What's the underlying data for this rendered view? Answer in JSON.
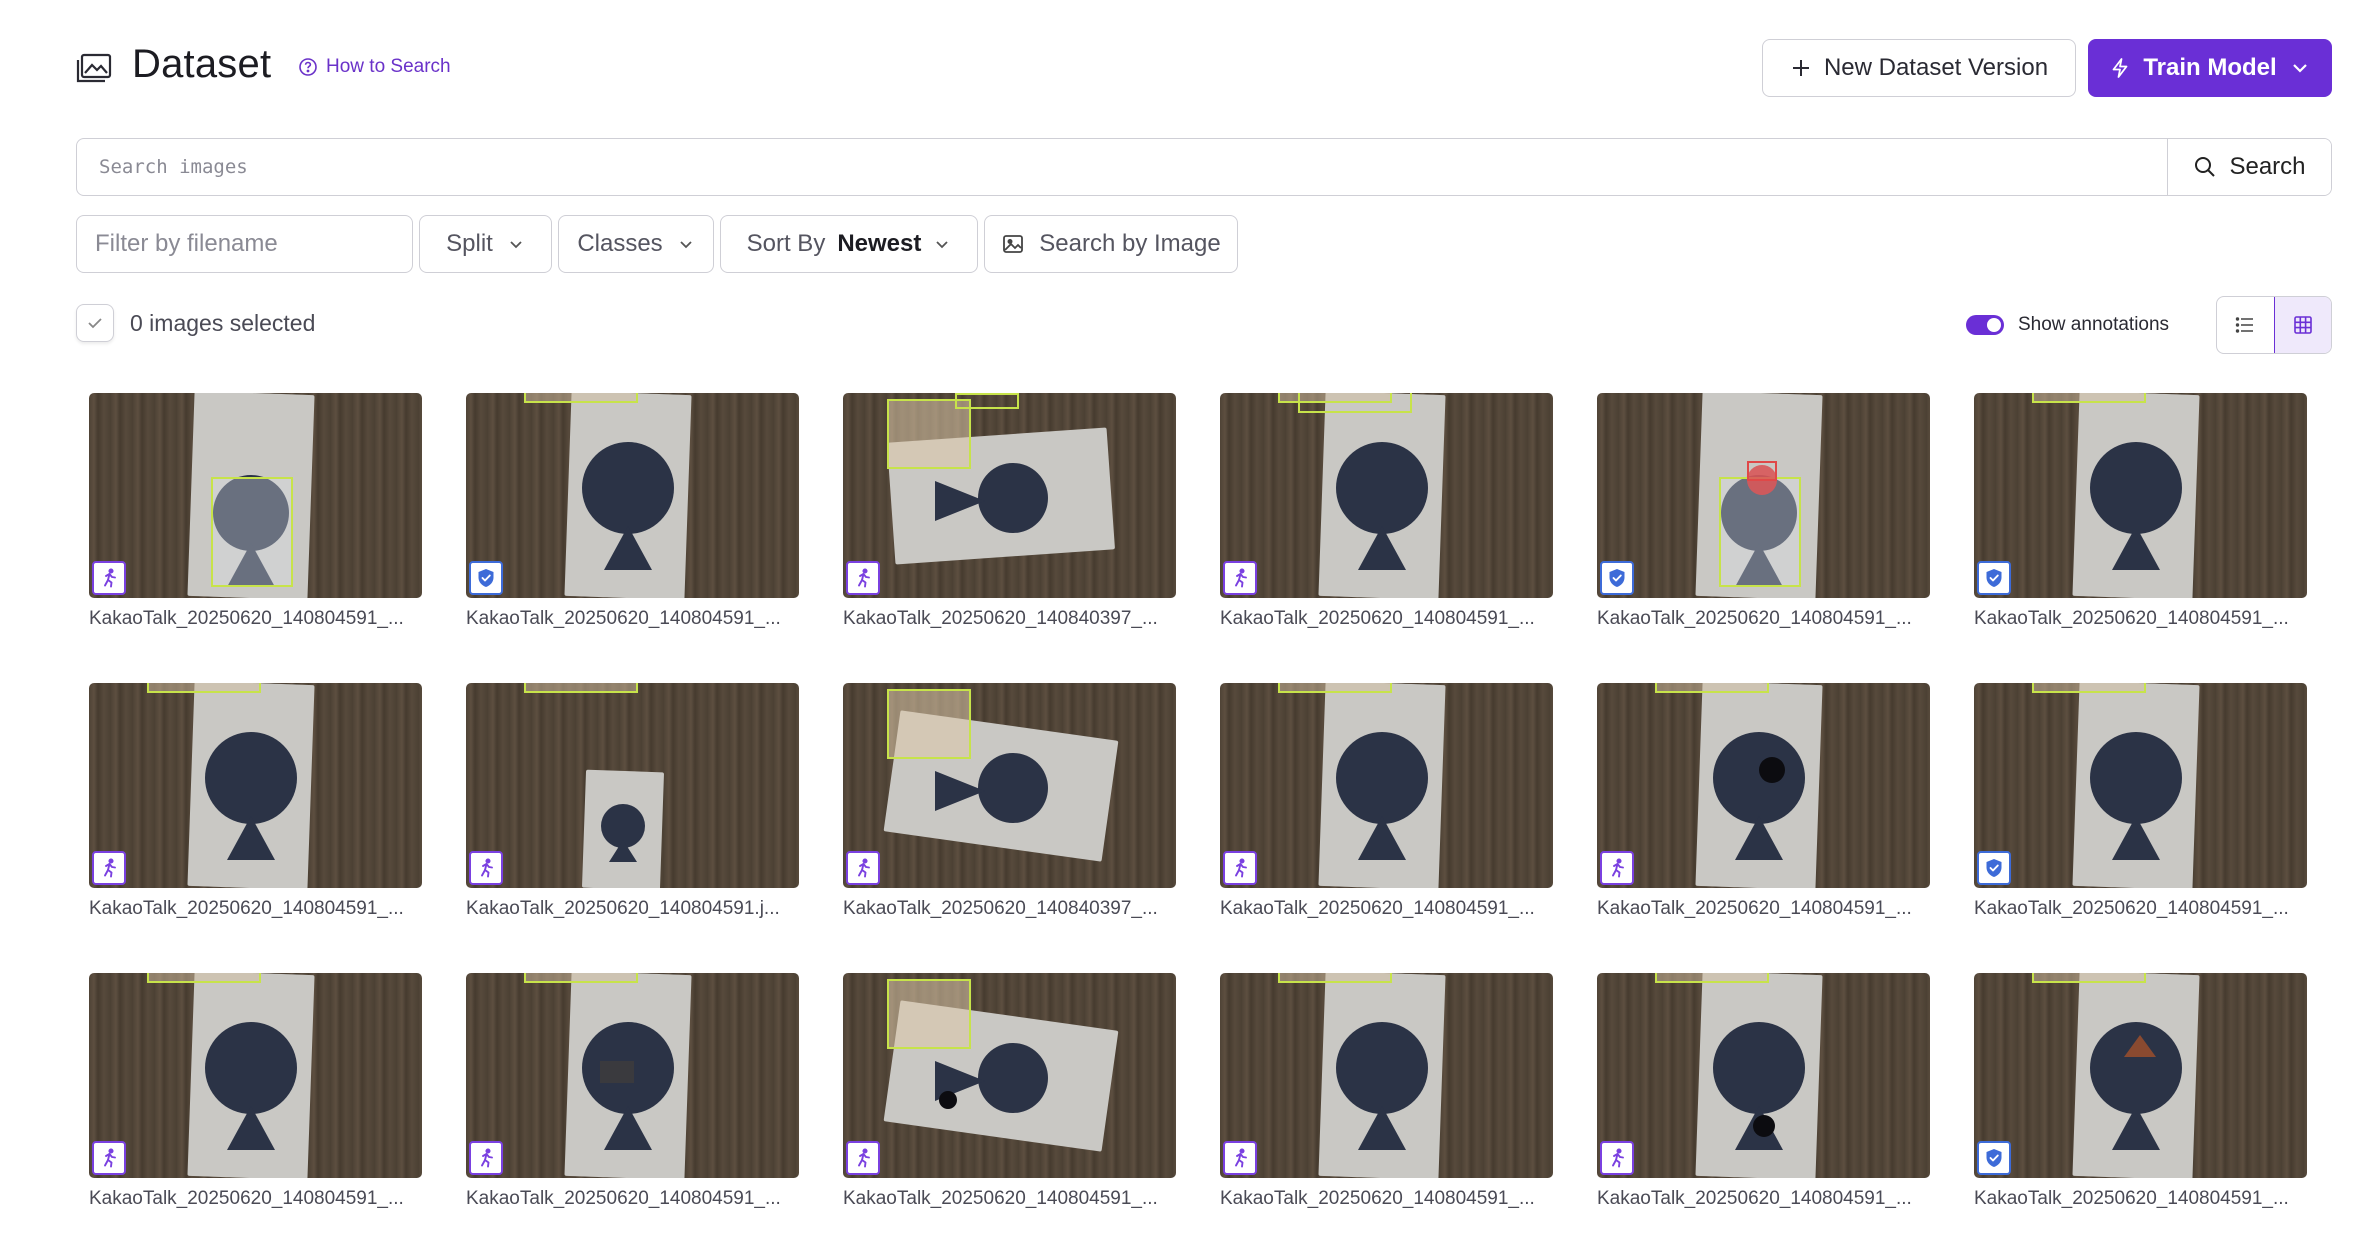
{
  "header": {
    "title": "Dataset",
    "title_icon": "image-gallery-icon",
    "how_to_search": "How to Search",
    "new_version_label": "New Dataset Version",
    "train_label": "Train Model"
  },
  "search": {
    "placeholder": "Search images",
    "button_label": "Search"
  },
  "filters": {
    "filename_placeholder": "Filter by filename",
    "split_label": "Split",
    "classes_label": "Classes",
    "sort_label": "Sort By",
    "sort_value": "Newest",
    "image_search_label": "Search by Image"
  },
  "selection": {
    "text": "0 images selected"
  },
  "annotations_toggle": {
    "label": "Show annotations",
    "on": true
  },
  "view": {
    "active": "grid"
  },
  "colors": {
    "accent": "#6a2fd6",
    "bbox": "#c7e34a",
    "train_badge": "#7a40e0",
    "valid_badge": "#3d6bd8"
  },
  "images": [
    {
      "name": "KakaoTalk_20250620_140804591_...",
      "split": "train",
      "split_icon": "running-person-icon"
    },
    {
      "name": "KakaoTalk_20250620_140804591_...",
      "split": "valid",
      "split_icon": "shield-check-icon"
    },
    {
      "name": "KakaoTalk_20250620_140840397_...",
      "split": "train",
      "split_icon": "running-person-icon"
    },
    {
      "name": "KakaoTalk_20250620_140804591_...",
      "split": "train",
      "split_icon": "running-person-icon"
    },
    {
      "name": "KakaoTalk_20250620_140804591_...",
      "split": "valid",
      "split_icon": "shield-check-icon"
    },
    {
      "name": "KakaoTalk_20250620_140804591_...",
      "split": "valid",
      "split_icon": "shield-check-icon"
    },
    {
      "name": "KakaoTalk_20250620_140804591_...",
      "split": "train",
      "split_icon": "running-person-icon"
    },
    {
      "name": "KakaoTalk_20250620_140804591.j...",
      "split": "train",
      "split_icon": "running-person-icon"
    },
    {
      "name": "KakaoTalk_20250620_140840397_...",
      "split": "train",
      "split_icon": "running-person-icon"
    },
    {
      "name": "KakaoTalk_20250620_140804591_...",
      "split": "train",
      "split_icon": "running-person-icon"
    },
    {
      "name": "KakaoTalk_20250620_140804591_...",
      "split": "train",
      "split_icon": "running-person-icon"
    },
    {
      "name": "KakaoTalk_20250620_140804591_...",
      "split": "valid",
      "split_icon": "shield-check-icon"
    },
    {
      "name": "KakaoTalk_20250620_140804591_...",
      "split": "train",
      "split_icon": "running-person-icon"
    },
    {
      "name": "KakaoTalk_20250620_140804591_...",
      "split": "train",
      "split_icon": "running-person-icon"
    },
    {
      "name": "KakaoTalk_20250620_140804591_...",
      "split": "train",
      "split_icon": "running-person-icon"
    },
    {
      "name": "KakaoTalk_20250620_140804591_...",
      "split": "train",
      "split_icon": "running-person-icon"
    },
    {
      "name": "KakaoTalk_20250620_140804591_...",
      "split": "train",
      "split_icon": "running-person-icon"
    },
    {
      "name": "KakaoTalk_20250620_140804591_...",
      "split": "valid",
      "split_icon": "shield-check-icon"
    }
  ]
}
